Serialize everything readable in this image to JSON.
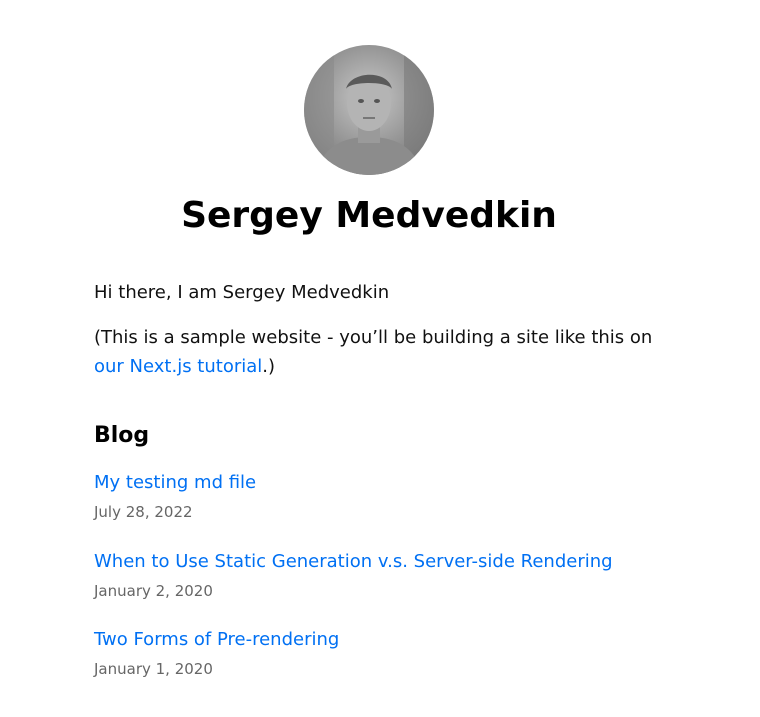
{
  "profile": {
    "name": "Sergey Medvedkin",
    "avatar_icon": "profile-photo"
  },
  "intro": {
    "greeting": "Hi there, I am Sergey Medvedkin",
    "sample_note_prefix": "(This is a sample website - you’ll be building a site like this on ",
    "tutorial_link_text": "our Next.js tutorial",
    "sample_note_suffix": ".)"
  },
  "blog": {
    "heading": "Blog",
    "posts": [
      {
        "title": "My testing md file",
        "date": "July 28, 2022"
      },
      {
        "title": "When to Use Static Generation v.s. Server-side Rendering",
        "date": "January 2, 2020"
      },
      {
        "title": "Two Forms of Pre-rendering",
        "date": "January 1, 2020"
      }
    ]
  },
  "colors": {
    "link": "#0070f3",
    "date": "#666666",
    "text": "#111111"
  }
}
